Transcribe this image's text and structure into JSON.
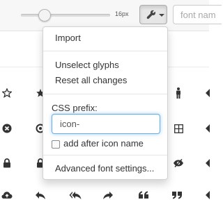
{
  "toolbar": {
    "font_size_label": "16px",
    "font_size_fraction": 0.25,
    "tools_icon": "wrench-icon",
    "font_name_placeholder": "font nam"
  },
  "menu": {
    "import_label": "Import",
    "unselect_label": "Unselect glyphs",
    "reset_label": "Reset all changes",
    "css_prefix_label": "CSS prefix:",
    "css_prefix_value": "icon-",
    "add_after_label": "add after icon name",
    "add_after_checked": false,
    "advanced_label": "Advanced font settings..."
  },
  "glyphs": [
    "star-outline-icon",
    "star-icon",
    "male-icon",
    "arrow-icon",
    "remove-sign-icon",
    "target-icon",
    "grid-icon",
    "arrow-icon",
    "lock-icon",
    "lock-icon",
    "eye-slash-icon",
    "arrow-icon",
    "cloud-upload-icon",
    "reply-icon",
    "reply-all-icon",
    "share-icon",
    "quote-left-icon",
    "quote-right-icon",
    "arrow-icon"
  ],
  "colors": {
    "focus_border": "#66afe9",
    "glyph_color": "#333333",
    "menu_border": "#cccccc"
  }
}
